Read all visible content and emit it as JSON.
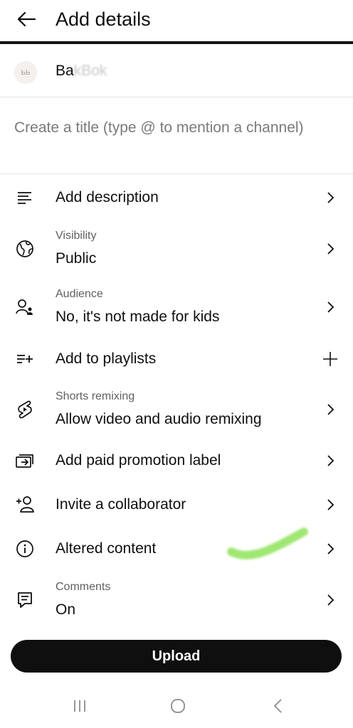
{
  "header": {
    "title": "Add details"
  },
  "channel": {
    "avatar_text": "ЬЬ",
    "name_visible": "Ba",
    "name_obscured": "kBok"
  },
  "title_field": {
    "placeholder": "Create a title (type @ to mention a channel)"
  },
  "rows": {
    "description": {
      "label": "Add description",
      "icon": "description-icon"
    },
    "visibility": {
      "sublabel": "Visibility",
      "value": "Public",
      "icon": "globe-icon"
    },
    "audience": {
      "sublabel": "Audience",
      "value": "No, it's not made for kids",
      "icon": "audience-icon"
    },
    "playlists": {
      "label": "Add to playlists",
      "icon": "playlist-add-icon"
    },
    "remixing": {
      "sublabel": "Shorts remixing",
      "value": "Allow video and audio remixing",
      "icon": "remix-icon"
    },
    "paid_promotion": {
      "label": "Add paid promotion label",
      "icon": "paid-promotion-icon"
    },
    "collaborator": {
      "label": "Invite a collaborator",
      "icon": "add-person-icon"
    },
    "altered_content": {
      "label": "Altered content",
      "icon": "info-icon"
    },
    "comments": {
      "sublabel": "Comments",
      "value": "On",
      "icon": "comment-icon"
    }
  },
  "upload": {
    "label": "Upload"
  },
  "colors": {
    "primary_text": "#0f0f0f",
    "secondary_text": "#606060",
    "button_bg": "#0f0f0f",
    "scribble": "#8fe35a"
  }
}
